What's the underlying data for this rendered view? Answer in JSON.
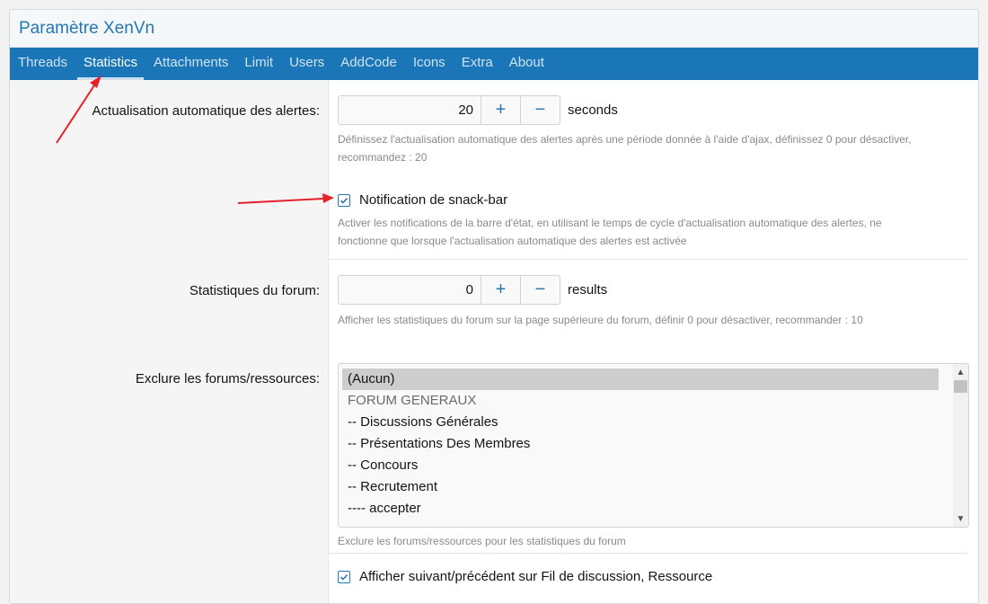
{
  "header": {
    "title": "Paramètre XenVn"
  },
  "tabs": [
    {
      "label": "Threads"
    },
    {
      "label": "Statistics"
    },
    {
      "label": "Attachments"
    },
    {
      "label": "Limit"
    },
    {
      "label": "Users"
    },
    {
      "label": "AddCode"
    },
    {
      "label": "Icons"
    },
    {
      "label": "Extra"
    },
    {
      "label": "About"
    }
  ],
  "settings": {
    "alerts": {
      "label": "Actualisation automatique des alertes:",
      "value": "20",
      "unit": "seconds",
      "hint_line1": "Définissez l'actualisation automatique des alertes après une période donnée à l'aide d'ajax, définissez 0 pour désactiver,",
      "hint_line2": "recommandez : 20"
    },
    "snackbar": {
      "label": "Notification de snack-bar",
      "checked": true,
      "hint_line1": "Activer les notifications de la barre d'état, en utilisant le temps de cycle d'actualisation automatique des alertes, ne",
      "hint_line2": "fonctionne que lorsque l'actualisation automatique des alertes est activée"
    },
    "forum_stats": {
      "label": "Statistiques du forum:",
      "value": "0",
      "unit": "results",
      "hint": "Afficher les statistiques du forum sur la page supérieure du forum, définir 0 pour désactiver, recommander : 10"
    },
    "exclude": {
      "label": "Exclure les forums/ressources:",
      "options": [
        "(Aucun)",
        "FORUM GENERAUX",
        "-- Discussions Générales",
        "-- Présentations Des Membres",
        "-- Concours",
        "-- Recrutement",
        "---- accepter"
      ],
      "selected": "(Aucun)",
      "hint": "Exclure les forums/ressources pour les statistiques du forum"
    },
    "prev_next": {
      "label": "Afficher suivant/précédent sur Fil de discussion, Ressource",
      "checked": true
    }
  },
  "icons": {
    "plus": "+",
    "minus": "−",
    "check": "check-icon",
    "scroll_up": "▲",
    "scroll_down": "▼"
  },
  "colors": {
    "accent": "#2577b1",
    "tab_bar": "#1b76b8",
    "arrow": "#e8202a"
  }
}
